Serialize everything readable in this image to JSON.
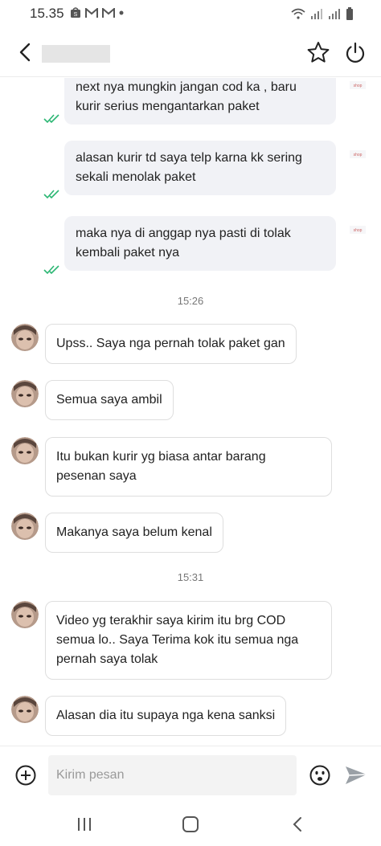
{
  "status_bar": {
    "time": "15.35"
  },
  "header": {
    "star_label": "star",
    "power_label": "power"
  },
  "messages_out": [
    {
      "line1": "next nya mungkin jangan cod ka , baru",
      "line2": "kurir serius mengantarkan paket"
    },
    {
      "line1": "alasan kurir td saya telp karna kk sering",
      "line2": "sekali menolak paket"
    },
    {
      "line1": "maka nya di anggap nya pasti di tolak",
      "line2": "kembali paket nya"
    }
  ],
  "time_separators": [
    "15:26",
    "15:31"
  ],
  "messages_in": [
    {
      "lines": [
        "Upss.. Saya nga pernah tolak paket gan"
      ]
    },
    {
      "lines": [
        "Semua saya ambil"
      ]
    },
    {
      "lines": [
        "Itu bukan kurir yg biasa antar barang",
        "pesenan saya"
      ]
    },
    {
      "lines": [
        "Makanya saya belum kenal"
      ]
    },
    {
      "lines": [
        "Video yg terakhir saya kirim itu brg COD",
        "semua lo.. Saya Terima kok itu semua nga",
        "pernah saya tolak"
      ]
    },
    {
      "lines": [
        "Alasan dia itu supaya nga kena sanksi"
      ]
    }
  ],
  "input": {
    "placeholder": "Kirim pesan"
  },
  "colors": {
    "check": "#2bb673",
    "bubble_out": "#f1f2f6",
    "bubble_in_border": "#dedede",
    "send_icon": "#9aa0a6"
  },
  "icons": {
    "back": "chevron-left-icon",
    "star": "star-icon",
    "power": "power-icon",
    "add": "plus-circle-icon",
    "emoji": "emoji-icon",
    "send": "send-icon",
    "nav_recent": "recent-apps-icon",
    "nav_home": "home-icon",
    "nav_back": "nav-back-icon"
  }
}
